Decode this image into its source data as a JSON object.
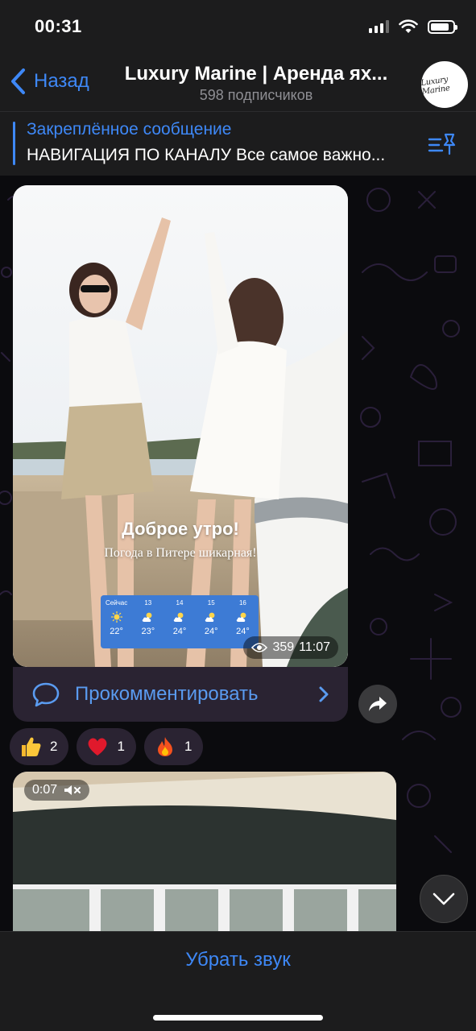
{
  "status": {
    "time": "00:31",
    "battery_level": 0.85
  },
  "header": {
    "back_label": "Назад",
    "title": "Luxury Marine | Аренда ях...",
    "subtitle": "598 подписчиков",
    "avatar_text": "Luxury Marine"
  },
  "pinned": {
    "title": "Закреплённое сообщение",
    "text": "НАВИГАЦИЯ ПО КАНАЛУ Все самое важно..."
  },
  "post": {
    "heading": "Доброе утро!",
    "subheading": "Погода в Питере шикарная!",
    "weather": [
      {
        "label": "Сейчас",
        "temp": "22°",
        "icon": "sun-icon"
      },
      {
        "label": "13",
        "temp": "23°",
        "icon": "partly-cloudy-icon"
      },
      {
        "label": "14",
        "temp": "24°",
        "icon": "partly-cloudy-icon"
      },
      {
        "label": "15",
        "temp": "24°",
        "icon": "partly-cloudy-icon"
      },
      {
        "label": "16",
        "temp": "24°",
        "icon": "partly-cloudy-icon"
      }
    ],
    "views": "359",
    "time": "11:07",
    "comment_label": "Прокомментировать"
  },
  "reactions": [
    {
      "emoji": "thumbs-up-emoji",
      "count": "2"
    },
    {
      "emoji": "red-heart-emoji",
      "count": "1"
    },
    {
      "emoji": "fire-emoji",
      "count": "1"
    }
  ],
  "video": {
    "duration": "0:07"
  },
  "bottom": {
    "action_label": "Убрать звук"
  },
  "colors": {
    "accent": "#3e88f7",
    "bar_bg": "#1c1c1d",
    "bubble_bg": "#2a2332",
    "weather_bg": "#3d7bd5"
  }
}
